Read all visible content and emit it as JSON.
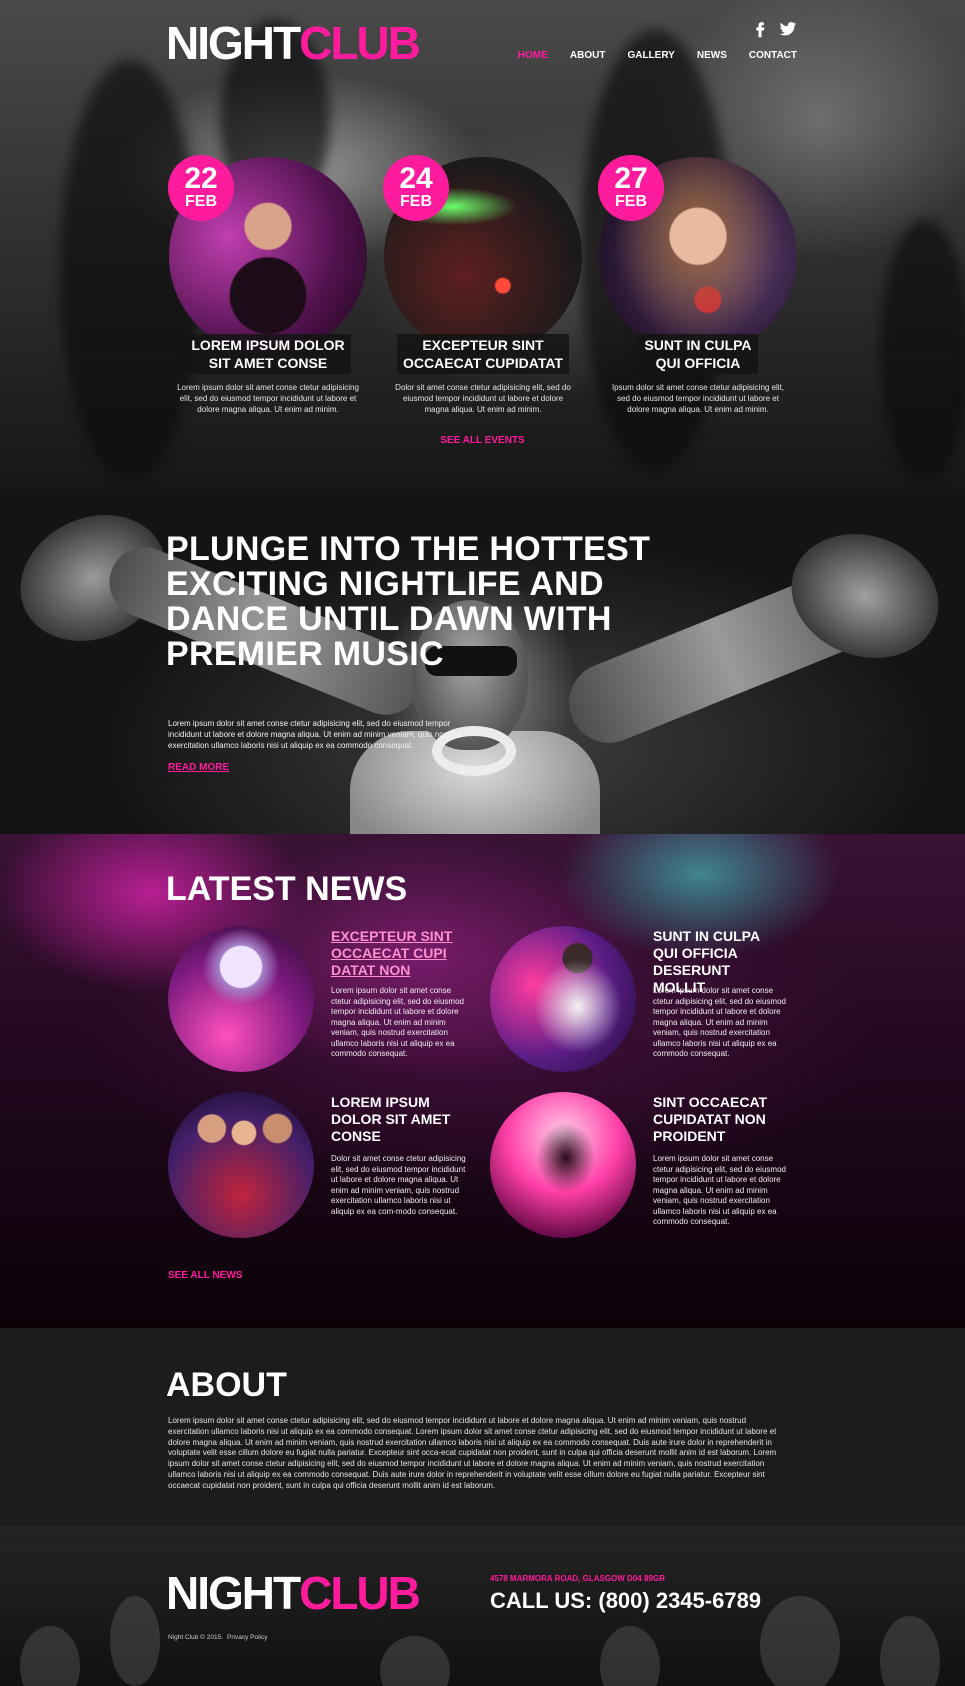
{
  "brand": {
    "name_white": "NIGHT",
    "name_pink": "CLUB"
  },
  "colors": {
    "accent": "#ff1b9d",
    "background": "#000000",
    "about_bg": "#1c1c1c"
  },
  "header": {
    "social": [
      "facebook-icon",
      "twitter-icon"
    ],
    "nav": [
      {
        "label": "HOME",
        "active": true
      },
      {
        "label": "ABOUT",
        "active": false
      },
      {
        "label": "GALLERY",
        "active": false
      },
      {
        "label": "NEWS",
        "active": false
      },
      {
        "label": "CONTACT",
        "active": false
      }
    ]
  },
  "events": [
    {
      "day": "22",
      "month": "FEB",
      "title_1": "LOREM IPSUM DOLOR",
      "title_2": "SIT AMET CONSE",
      "desc": "Lorem ipsum dolor sit amet conse ctetur adipisicing elit, sed do eiusmod tempor incididunt ut labore et dolore magna aliqua. Ut enim ad minim."
    },
    {
      "day": "24",
      "month": "FEB",
      "title_1": "EXCEPTEUR SINT",
      "title_2": "OCCAECAT CUPIDATAT",
      "desc": "Dolor sit amet conse ctetur adipisicing elit, sed do eiusmod tempor incididunt ut labore et dolore magna aliqua. Ut enim ad minim."
    },
    {
      "day": "27",
      "month": "FEB",
      "title_1": "SUNT IN CULPA",
      "title_2": "QUI OFFICIA",
      "desc": "Ipsum dolor sit amet conse ctetur adipisicing elit, sed do eiusmod tempor incididunt ut labore et dolore magna aliqua. Ut enim ad minim."
    }
  ],
  "see_all_events": "SEE ALL EVENTS",
  "promo": {
    "title": "PLUNGE INTO THE HOTTEST EXCITING NIGHTLIFE AND DANCE UNTIL DAWN WITH PREMIER MUSIC",
    "desc": "Lorem ipsum dolor sit amet conse ctetur adipisicing elit, sed do eiusmod tempor incididunt ut labore et dolore magna aliqua. Ut enim ad minim veniam, quis nostrud exercitation ullamco laboris nisi ut aliquip ex ea commodo consequat.",
    "read_more": "READ MORE"
  },
  "news": {
    "title": "LATEST NEWS",
    "items": [
      {
        "title": "EXCEPTEUR SINT OCCAECAT CUPI DATAT NON",
        "desc": "Lorem ipsum dolor sit amet conse ctetur adipisicing elit, sed do eiusmod tempor incididunt ut labore et dolore magna aliqua. Ut enim ad minim veniam, quis nostrud exercitation ullamco laboris nisi ut aliquip ex ea commodo consequat."
      },
      {
        "title": "SUNT IN CULPA QUI OFFICIA DESERUNT MOLLIT",
        "desc": "Lorem ipsum dolor sit amet conse ctetur adipisicing elit, sed do eiusmod tempor incididunt ut labore et dolore magna aliqua. Ut enim ad minim veniam, quis nostrud exercitation ullamco laboris nisi ut aliquip ex ea commodo consequat."
      },
      {
        "title": "LOREM IPSUM DOLOR SIT AMET CONSE",
        "desc": "Dolor sit amet conse ctetur adipisicing elit, sed do eiusmod tempor incididunt ut labore et dolore magna aliqua. Ut enim ad minim veniam, quis nostrud exercitation ullamco laboris nisi ut aliquip ex ea com-modo consequat."
      },
      {
        "title": "SINT OCCAECAT CUPIDATAT NON PROIDENT",
        "desc": "Lorem ipsum dolor sit amet conse ctetur adipisicing elit, sed do eiusmod tempor incididunt ut labore et dolore magna aliqua. Ut enim ad minim veniam, quis nostrud exercitation ullamco laboris nisi ut aliquip ex ea commodo consequat."
      }
    ],
    "see_all": "SEE ALL NEWS"
  },
  "about": {
    "title": "ABOUT",
    "text": "Lorem ipsum dolor sit amet conse ctetur adipisicing elit, sed do eiusmod tempor incididunt ut labore et dolore magna aliqua. Ut enim ad minim veniam, quis nostrud exercitation ullamco laboris nisi ut aliquip ex ea commodo consequat. Lorem ipsum dolor sit amet conse ctetur adipisicing elit, sed do eiusmod tempor incididunt ut labore et dolore magna aliqua. Ut enim ad minim veniam, quis nostrud exercitation ullamco laboris nisi ut aliquip ex ea commodo consequat. Duis aute irure dolor in reprehenderit in voluptate velit esse cillum dolore eu fugiat nulla pariatur. Excepteur sint occa-ecat cupidatat non proident, sunt in culpa qui officia deserunt mollit anim id est laborum. Lorem ipsum dolor sit amet conse ctetur adipisicing elit, sed do eiusmod tempor incididunt ut labore et dolore magna aliqua. Ut enim ad minim veniam, quis nostrud exercitation ullamco laboris nisi ut aliquip ex ea commodo consequat. Duis aute irure dolor in reprehenderit in voluptate velit esse cillum dolore eu fugiat nulla pariatur. Excepteur sint occaecat cupidatat non proident, sunt in culpa qui officia deserunt mollit anim id est laborum."
  },
  "footer": {
    "address": "4578 MARMORA ROAD, GLASGOW D04 89GR",
    "call": "CALL US: (800) 2345-6789",
    "copyright": "Night Club © 2015.",
    "privacy": "Privacy Policy"
  }
}
